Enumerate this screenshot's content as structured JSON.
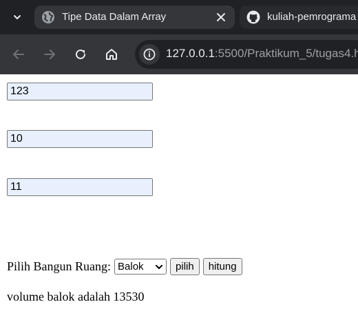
{
  "browser": {
    "tabs": [
      {
        "title": "Tipe Data Dalam Array",
        "active": true,
        "favicon": "globe-icon"
      },
      {
        "title": "kuliah-pemrograma",
        "active": false,
        "favicon": "github-icon"
      }
    ],
    "address": {
      "host": "127.0.0.1",
      "path": ":5500/Praktikum_5/tugas4.h"
    }
  },
  "form": {
    "inputs": [
      {
        "value": "123"
      },
      {
        "value": "10"
      },
      {
        "value": "11"
      }
    ],
    "select_label": "Pilih Bangun Ruang:",
    "select_value": "Balok",
    "buttons": {
      "pilih": "pilih",
      "hitung": "hitung"
    },
    "result": "volume balok adalah 13530"
  },
  "colors": {
    "tabstrip": "#202124",
    "toolbar": "#35363a",
    "autofill_bg": "#e8f0fe"
  }
}
